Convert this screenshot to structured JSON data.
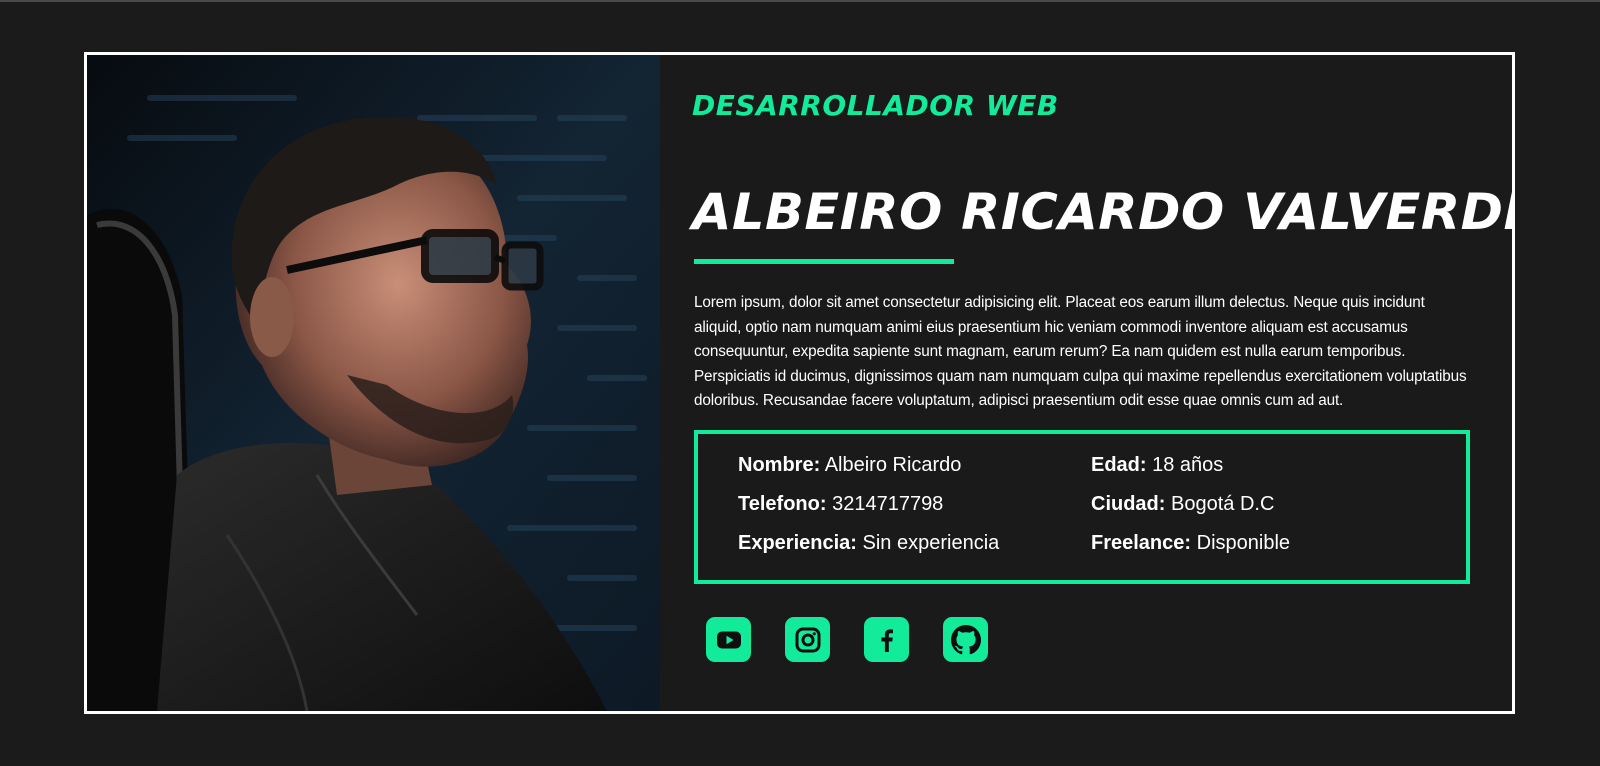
{
  "profile": {
    "role": "DESARROLLADOR WEB",
    "name": "ALBEIRO RICARDO VALVERDE",
    "bio": "Lorem ipsum, dolor sit amet consectetur adipisicing elit. Placeat eos earum illum delectus. Neque quis incidunt aliquid, optio nam numquam animi eius praesentium hic veniam commodi inventore aliquam est accusamus consequuntur, expedita sapiente sunt magnam, earum rerum? Ea nam quidem est nulla earum temporibus. Perspiciatis id ducimus, dignissimos quam nam numquam culpa qui maxime repellendus exercitationem voluptatibus doloribus. Recusandae facere voluptatum, adipisci praesentium odit esse quae omnis cum ad aut."
  },
  "info": {
    "nombre": {
      "label": "Nombre:",
      "value": "Albeiro Ricardo"
    },
    "telefono": {
      "label": "Telefono:",
      "value": "3214717798"
    },
    "experiencia": {
      "label": "Experiencia:",
      "value": "Sin experiencia"
    },
    "edad": {
      "label": "Edad:",
      "value": "18 años"
    },
    "ciudad": {
      "label": "Ciudad:",
      "value": "Bogotá D.C"
    },
    "freelance": {
      "label": "Freelance:",
      "value": "Disponible"
    }
  },
  "social": [
    {
      "icon": "youtube-icon"
    },
    {
      "icon": "instagram-icon"
    },
    {
      "icon": "facebook-icon"
    },
    {
      "icon": "github-icon"
    }
  ],
  "colors": {
    "accent": "#12ec9a",
    "background": "#1b1b1b",
    "card": "#1a1a1a",
    "border": "#ffffff",
    "text": "#ffffff"
  }
}
